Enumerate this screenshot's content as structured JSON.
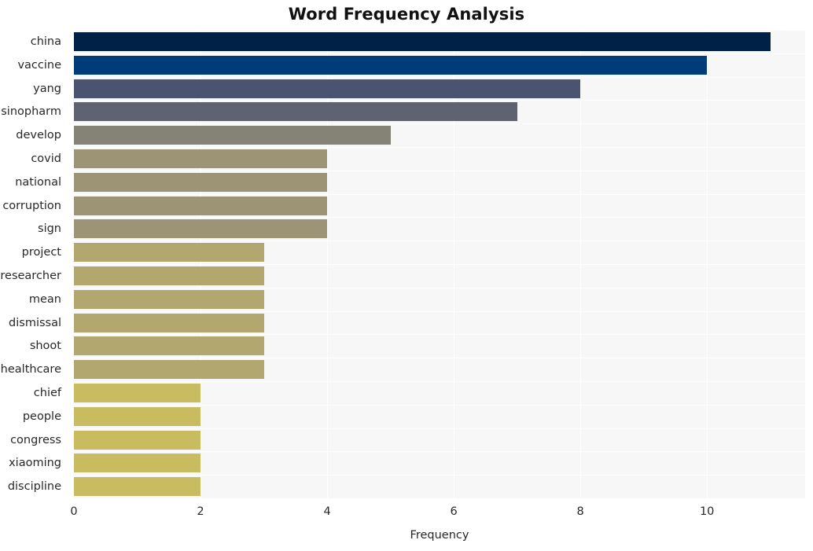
{
  "chart_data": {
    "type": "bar",
    "orientation": "horizontal",
    "title": "Word Frequency Analysis",
    "xlabel": "Frequency",
    "ylabel": "",
    "categories": [
      "china",
      "vaccine",
      "yang",
      "sinopharm",
      "develop",
      "covid",
      "national",
      "corruption",
      "sign",
      "project",
      "researcher",
      "mean",
      "dismissal",
      "shoot",
      "healthcare",
      "chief",
      "people",
      "congress",
      "xiaoming",
      "discipline"
    ],
    "values": [
      11,
      10,
      8,
      7,
      5,
      4,
      4,
      4,
      4,
      3,
      3,
      3,
      3,
      3,
      3,
      2,
      2,
      2,
      2,
      2
    ],
    "bar_colors": [
      "#002147",
      "#003b7a",
      "#4a5472",
      "#5e6271",
      "#858375",
      "#9d9476",
      "#9d9476",
      "#9d9476",
      "#9d9476",
      "#b2a86f",
      "#b2a86f",
      "#b2a86f",
      "#b2a86f",
      "#b2a86f",
      "#b2a86f",
      "#c9bc60",
      "#c9bc60",
      "#c9bc60",
      "#c9bc60",
      "#c9bc60"
    ],
    "xticks": [
      0,
      2,
      4,
      6,
      8,
      10
    ],
    "xtick_labels": [
      "0",
      "2",
      "4",
      "6",
      "8",
      "10"
    ],
    "xlim": [
      0,
      11.55
    ],
    "grid": true,
    "grid_color": "#ffffff",
    "plot_background": "#f7f7f7",
    "figure_background": "#ffffff",
    "legend": null
  }
}
